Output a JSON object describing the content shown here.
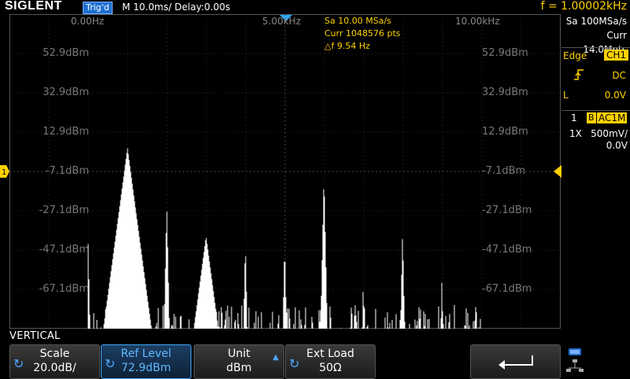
{
  "header": {
    "brand": "SIGLENT",
    "trigger_state": "Trig'd",
    "timebase": "M 10.0ms/ Delay:0.00s",
    "frequency": "f = 1.00002kHz"
  },
  "fft_info": {
    "sample_rate": "Sa 10.00 MSa/s",
    "points": "Curr 1048576 pts",
    "delta_f": "△f 9.54 Hz"
  },
  "freq_axis": {
    "left": "0.00Hz",
    "center": "5.00kHz",
    "right": "10.00kHz"
  },
  "level_labels": [
    "52.9dBm",
    "32.9dBm",
    "12.9dBm",
    "-7.1dBm",
    "-27.1dBm",
    "-47.1dBm",
    "-67.1dBm"
  ],
  "acquisition": {
    "sample_rate": "Sa 100MSa/s",
    "memory": "Curr 14.0Mpts"
  },
  "trigger": {
    "type_label": "Edge",
    "source": "CH1",
    "slope_icon": "rising-edge-icon",
    "coupling": "DC",
    "level_prefix": "L",
    "level": "0.0V"
  },
  "channel": {
    "number": "1",
    "bw_marker": "B",
    "coupling": "AC1M",
    "probe": "1X",
    "scale": "500mV/",
    "offset": "0.0V"
  },
  "menu": {
    "title": "VERTICAL",
    "scale_label": "Scale",
    "scale_value": "20.0dB/",
    "ref_label": "Ref Level",
    "ref_value": "72.9dBm",
    "unit_label": "Unit",
    "unit_value": "dBm",
    "load_label": "Ext Load",
    "load_value": "50Ω"
  },
  "spectrum_peaks_khz": [
    1,
    2,
    3,
    4,
    5,
    6,
    7,
    8,
    9,
    10
  ],
  "spectrum_peak_levels_dbm": [
    -44,
    5,
    -24,
    -40,
    -43,
    -44,
    -9,
    -63,
    -38,
    -62
  ],
  "colors": {
    "accent": "#ffd200",
    "trace": "#ffffff",
    "highlight": "#1e6fcf",
    "marker": "#ffd200"
  }
}
